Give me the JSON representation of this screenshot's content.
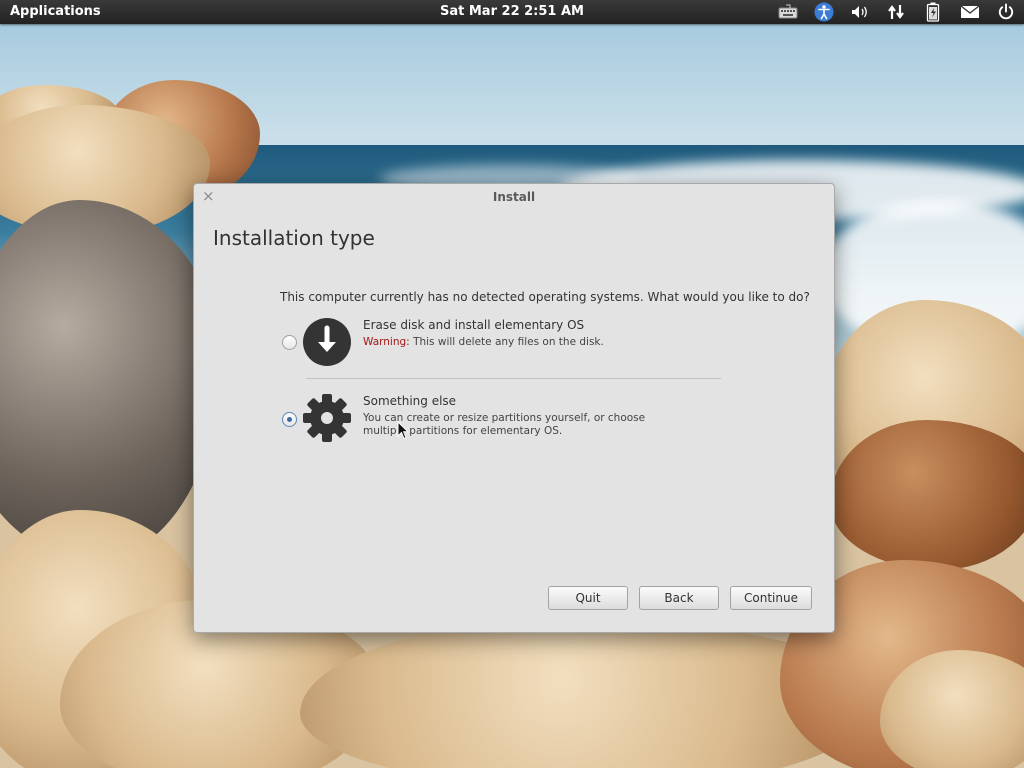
{
  "top_panel": {
    "applications_label": "Applications",
    "clock": "Sat Mar 22  2:51 AM",
    "tray_icons": [
      "keyboard-icon",
      "accessibility-icon",
      "volume-icon",
      "network-icon",
      "battery-icon",
      "mail-icon",
      "power-icon"
    ]
  },
  "window": {
    "title": "Install",
    "close_glyph": "×",
    "page_title": "Installation type",
    "question": "This computer currently has no detected operating systems. What would you like to do?",
    "options": [
      {
        "title": "Erase disk and install elementary OS",
        "warning_label": "Warning:",
        "description": "This will delete any files on the disk.",
        "icon": "download-arrow-icon",
        "selected": false
      },
      {
        "title": "Something else",
        "description_line1": "You can create or resize partitions yourself, or choose",
        "description_line2": "multiple partitions for elementary OS.",
        "icon": "gear-icon",
        "selected": true
      }
    ],
    "buttons": {
      "quit": "Quit",
      "back": "Back",
      "continue": "Continue"
    }
  },
  "colors": {
    "panel": "#2b2b2b",
    "dialog_bg": "#e3e3e3",
    "warning": "#a01818",
    "radio_selected": "#3e6da5",
    "icon_dark": "#333333"
  }
}
